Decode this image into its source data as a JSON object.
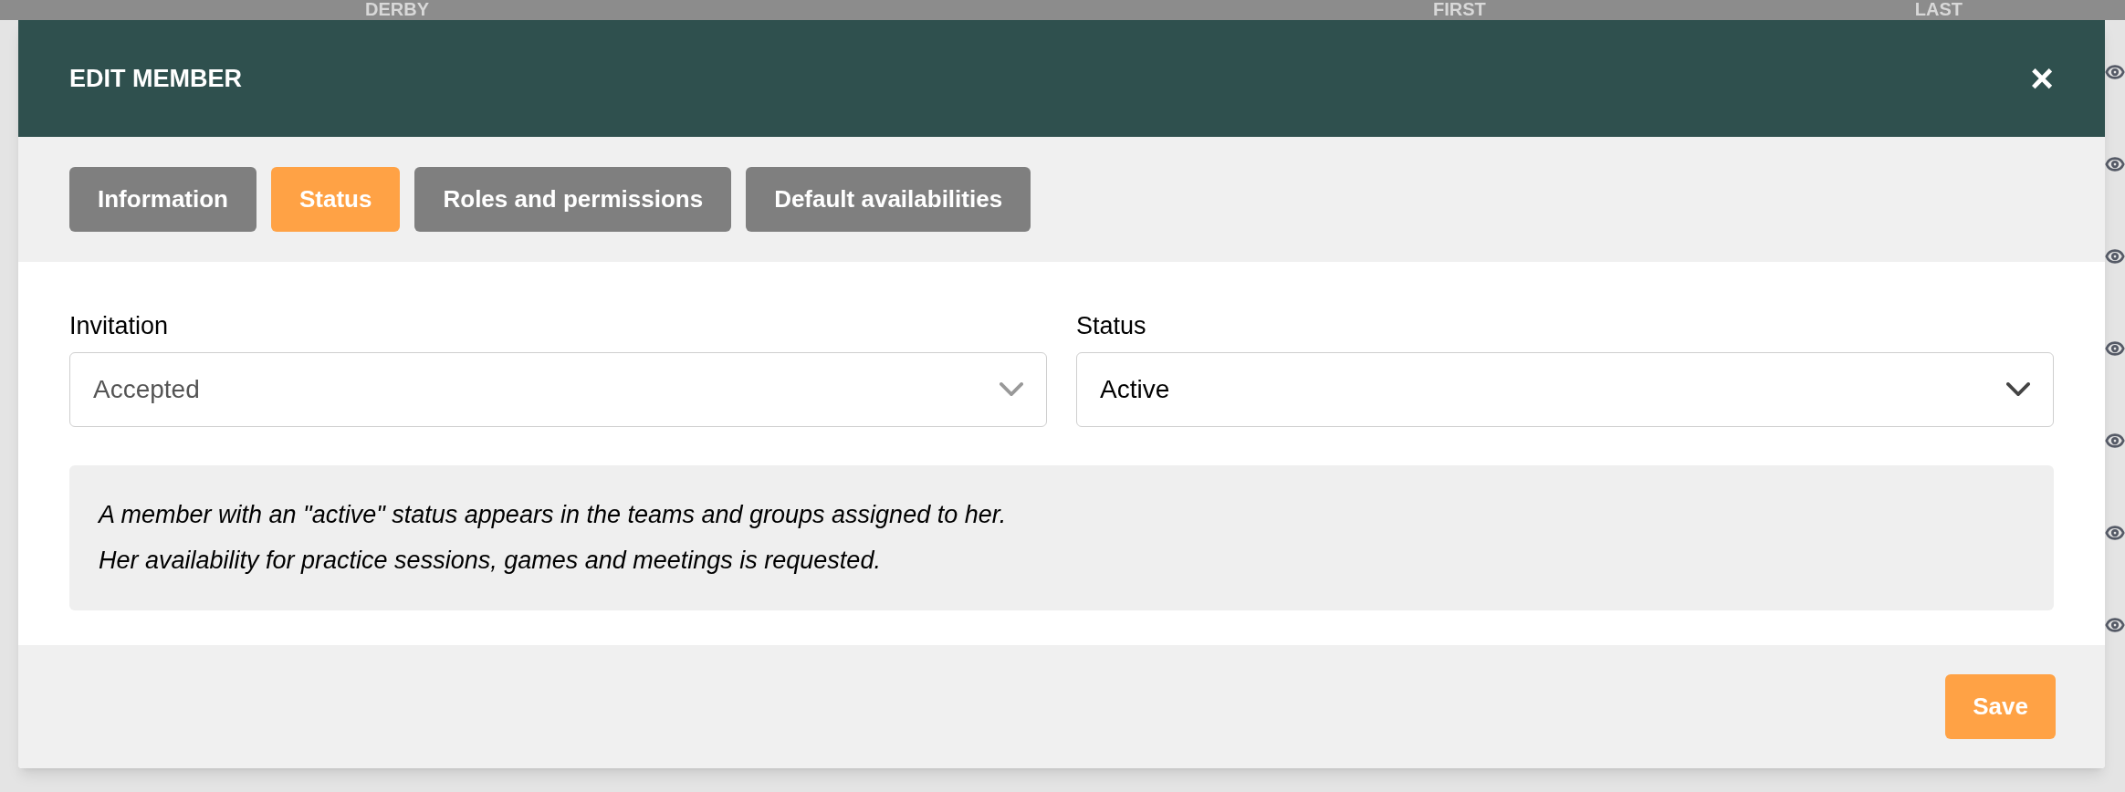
{
  "background_header": [
    "DERBY",
    "FIRST",
    "LAST"
  ],
  "dialog": {
    "title": "EDIT MEMBER",
    "close": "×"
  },
  "tabs": [
    {
      "label": "Information",
      "selected": false
    },
    {
      "label": "Status",
      "selected": true
    },
    {
      "label": "Roles and permissions",
      "selected": false
    },
    {
      "label": "Default availabilities",
      "selected": false
    }
  ],
  "fields": [
    {
      "label": "Invitation",
      "value": "Accepted",
      "disabled": true
    },
    {
      "label": "Status",
      "value": "Active",
      "disabled": false
    }
  ],
  "info": [
    "A member with an \"active\" status appears in the teams and groups assigned to her.",
    "Her availability for practice sessions, games and meetings is requested."
  ],
  "save_button": "Save"
}
